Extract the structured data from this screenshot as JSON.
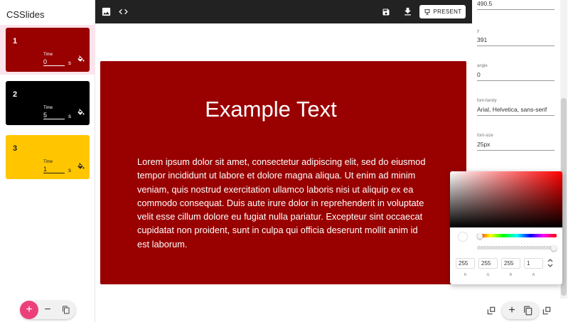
{
  "app": {
    "title": "CSSlides"
  },
  "slides": [
    {
      "number": "1",
      "time_label": "Time",
      "time_value": "0",
      "time_unit": "s",
      "background": "#990000",
      "text_color": "#ffffff",
      "selected": true
    },
    {
      "number": "2",
      "time_label": "Time",
      "time_value": "5",
      "time_unit": "s",
      "background": "#000000",
      "text_color": "#ffffff",
      "selected": false
    },
    {
      "number": "3",
      "time_label": "Time",
      "time_value": "1",
      "time_unit": "s",
      "background": "#ffc600",
      "text_color": "#222222",
      "selected": false
    }
  ],
  "sidebar_buttons": {
    "add": "+",
    "remove": "−"
  },
  "toolbar": {
    "present_label": "PRESENT"
  },
  "slide": {
    "title": "Example Text",
    "body": "Lorem ipsum dolor sit amet, consectetur adipiscing elit, sed do eiusmod tempor incididunt ut labore et dolore magna aliqua. Ut enim ad minim veniam, quis nostrud exercitation ullamco laboris nisi ut aliquip ex ea commodo consequat. Duis aute irure dolor in reprehenderit in voluptate velit esse cillum dolore eu fugiat nulla pariatur. Excepteur sint occaecat cupidatat non proident, sunt in culpa qui officia deserunt mollit anim id est laborum.",
    "background": "#990000"
  },
  "properties": {
    "x_value": "490.5",
    "y_label": "y",
    "y_value": "391",
    "angle_label": "angle",
    "angle_value": "0",
    "font_family_label": "font-family",
    "font_family_value": "Arial, Helvetica, sans-serif",
    "font_size_label": "font-size",
    "font_size_value": "25px"
  },
  "color_picker": {
    "r": "255",
    "g": "255",
    "b": "255",
    "a": "1",
    "r_label": "R",
    "g_label": "G",
    "b_label": "B",
    "a_label": "A",
    "hue_position": 0.0,
    "alpha_position": 1.0
  },
  "colors": {
    "accent": "#ec407a",
    "toolbar": "#222222",
    "selected_slide_bg": "#fce4ec"
  },
  "icons": {
    "toolbar": [
      "image-icon",
      "code-icon",
      "save-icon",
      "download-icon",
      "present-icon"
    ],
    "slide": [
      "paint-bucket-icon"
    ],
    "sidebar": [
      "plus-icon",
      "minus-icon",
      "copy-icon"
    ],
    "properties": [
      "send-back-icon",
      "plus-icon",
      "copy-icon",
      "bring-front-icon"
    ]
  }
}
